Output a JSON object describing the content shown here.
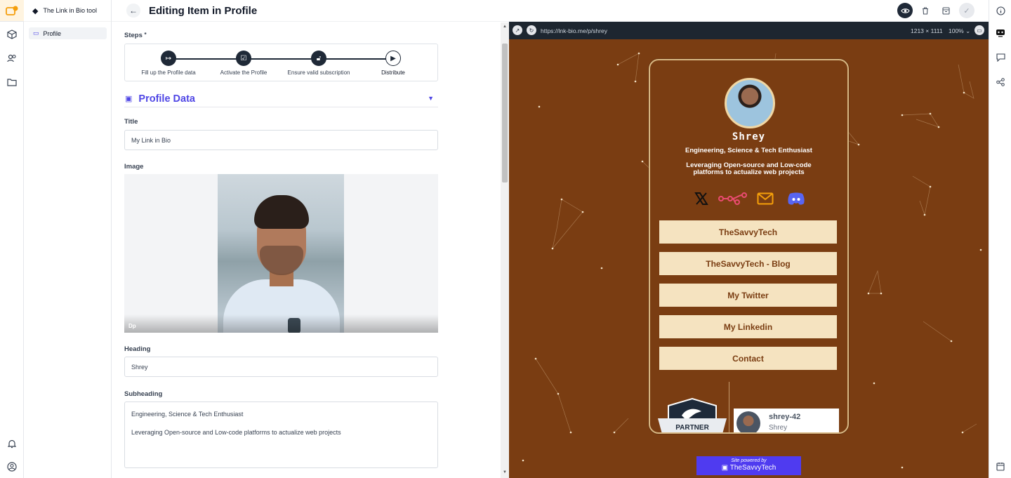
{
  "sidebar": {
    "app_name": "The Link in Bio tool",
    "items": [
      {
        "label": "Profile"
      }
    ]
  },
  "header": {
    "title": "Editing Item in Profile"
  },
  "steps": {
    "label": "Steps",
    "required_mark": "*",
    "items": [
      {
        "label": "Fill up the Profile data",
        "state": "done"
      },
      {
        "label": "Activate the Profile",
        "state": "done"
      },
      {
        "label": "Ensure valid subscription",
        "state": "done"
      },
      {
        "label": "Distribute",
        "state": "current"
      }
    ]
  },
  "section": {
    "title": "Profile Data"
  },
  "fields": {
    "title_label": "Title",
    "title_value": "My Link in Bio",
    "image_label": "Image",
    "image_caption": "Dp",
    "heading_label": "Heading",
    "heading_value": "Shrey",
    "subheading_label": "Subheading",
    "subheading_line1": "Engineering, Science & Tech Enthusiast",
    "subheading_line2": "Leveraging Open-source and Low-code platforms to actualize web projects"
  },
  "preview": {
    "url": "https://lnk-bio.me/p/shrey",
    "dimensions": "1213 × 1111",
    "zoom": "100%",
    "name": "Shrey",
    "subheading": "Engineering, Science & Tech Enthusiast",
    "description": "Leveraging Open-source and Low-code platforms to actualize web projects",
    "socials": [
      "x-icon",
      "n8n-icon",
      "email-icon",
      "discord-icon"
    ],
    "links": [
      {
        "label": "TheSavvyTech"
      },
      {
        "label": "TheSavvyTech - Blog"
      },
      {
        "label": "My Twitter"
      },
      {
        "label": "My Linkedin"
      },
      {
        "label": "Contact"
      }
    ],
    "partner_label": "PARTNER",
    "card_handle": "shrey-42",
    "card_name": "Shrey",
    "powered_line1": "Site powered by",
    "powered_line2": "TheSavvyTech"
  },
  "colors": {
    "accent": "#4f46e5",
    "preview_bg": "#7a3d12",
    "link_button_bg": "#f5e3c0",
    "powered_bg": "#4f3bf0"
  }
}
